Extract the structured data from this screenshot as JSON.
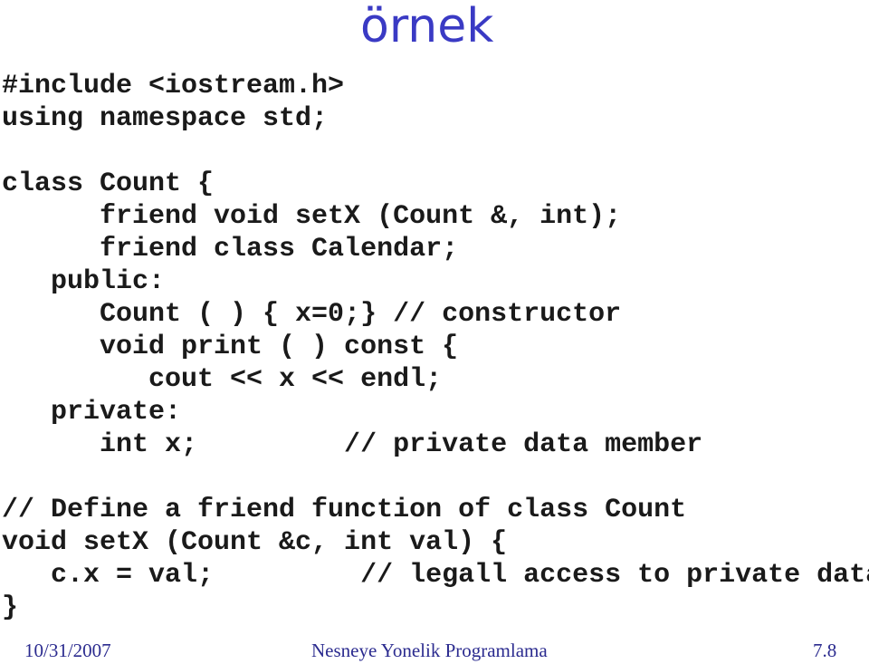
{
  "slide": {
    "title": "örnek",
    "code_lines": [
      "#include <iostream.h>",
      "using namespace std;",
      "",
      "class Count {",
      "      friend void setX (Count &, int);",
      "      friend class Calendar;",
      "   public:",
      "      Count ( ) { x=0;} // constructor",
      "      void print ( ) const {",
      "         cout << x << endl;",
      "   private:",
      "      int x;         // private data member",
      "",
      "// Define a friend function of class Count",
      "void setX (Count &c, int val) {",
      "   c.x = val;         // legall access to private data",
      "}"
    ],
    "footer": {
      "date": "10/31/2007",
      "course": "Nesneye Yonelik Programlama",
      "page": "7.8"
    }
  }
}
